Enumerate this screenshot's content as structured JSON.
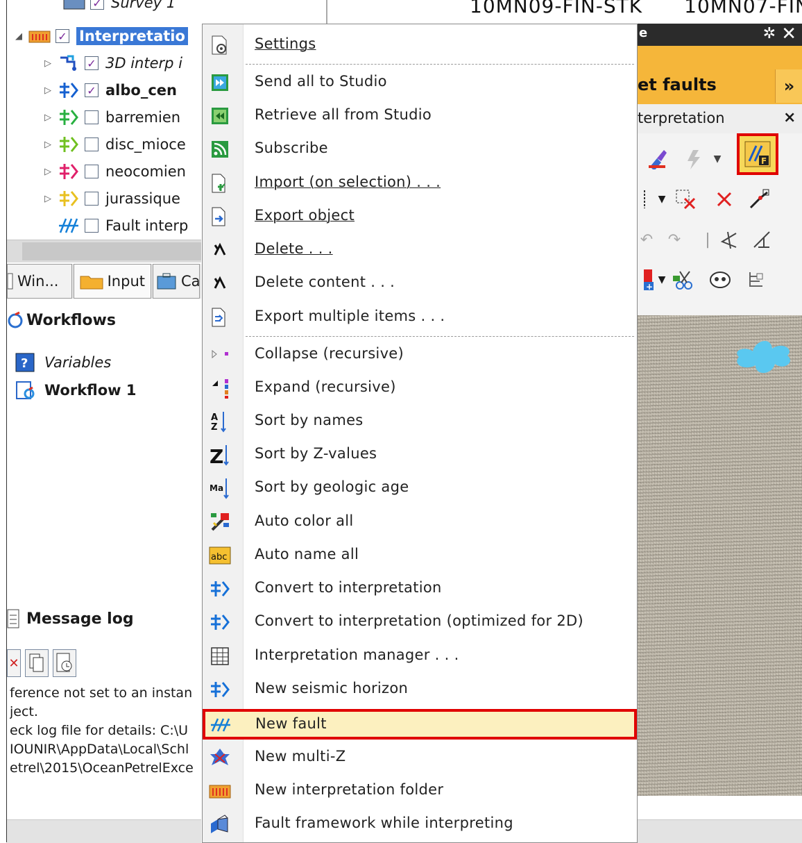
{
  "tree": {
    "items": [
      {
        "label": "Survey 1",
        "checked": true,
        "style": "italic"
      },
      {
        "label": "Interpretatio",
        "checked": true,
        "style": "selected"
      },
      {
        "label": "3D interp i",
        "checked": true,
        "style": "italic"
      },
      {
        "label": "albo_cen",
        "checked": true,
        "style": "bold"
      },
      {
        "label": "barremien",
        "checked": false,
        "style": "normal"
      },
      {
        "label": "disc_mioce",
        "checked": false,
        "style": "normal"
      },
      {
        "label": "neocomien",
        "checked": false,
        "style": "normal"
      },
      {
        "label": "jurassique",
        "checked": false,
        "style": "normal"
      },
      {
        "label": "Fault interp",
        "checked": false,
        "style": "normal"
      }
    ]
  },
  "tabs": [
    {
      "label": "Win...",
      "icon": "window-icon"
    },
    {
      "label": "Input",
      "icon": "folder-icon"
    },
    {
      "label": "Ca",
      "icon": "case-icon"
    }
  ],
  "workflows": {
    "title": "Workflows",
    "items": [
      {
        "label": "Variables",
        "style": "italic"
      },
      {
        "label": "Workflow 1",
        "style": "bold"
      }
    ]
  },
  "message_log": {
    "title": "Message log",
    "lines": [
      "ference not set to an instan",
      "ject.",
      "eck log file for details: C:\\U",
      "IOUNIR\\AppData\\Local\\Schl",
      "etrel\\2015\\OceanPetrelExce"
    ]
  },
  "seismic_header": {
    "columns": [
      "10MN09-FIN-STK",
      "10MN07-FIN"
    ]
  },
  "floating_window": {
    "title_fragment": "e",
    "tab_label": "et faults",
    "chevron": "»",
    "subtitle": "terpretation",
    "close": "×",
    "colors": {
      "title_bg": "#2b2b2b",
      "tab_bg": "#f5b63a",
      "highlight": "#e00000"
    }
  },
  "context_menu": {
    "items": [
      {
        "label": "Settings",
        "icon": "settings-icon",
        "underline": "S"
      },
      {
        "label": "Send all to Studio",
        "icon": "send-studio-icon"
      },
      {
        "label": "Retrieve all from Studio",
        "icon": "retrieve-studio-icon"
      },
      {
        "label": "Subscribe",
        "icon": "subscribe-icon"
      },
      {
        "label": "Import (on selection) . . .",
        "icon": "import-icon",
        "underline": "I"
      },
      {
        "label": "Export object",
        "icon": "export-icon",
        "underline": "E"
      },
      {
        "label": "Delete . . .",
        "icon": "delete-icon",
        "underline": "D"
      },
      {
        "label": "Delete content . . .",
        "icon": "delete-content-icon"
      },
      {
        "label": "Export multiple items . . .",
        "icon": "export-multiple-icon"
      },
      {
        "label": "Collapse (recursive)",
        "icon": "collapse-icon"
      },
      {
        "label": "Expand (recursive)",
        "icon": "expand-icon"
      },
      {
        "label": "Sort by names",
        "icon": "sort-names-icon"
      },
      {
        "label": "Sort by Z-values",
        "icon": "sort-z-icon"
      },
      {
        "label": "Sort by geologic age",
        "icon": "sort-age-icon"
      },
      {
        "label": "Auto color all",
        "icon": "auto-color-icon"
      },
      {
        "label": "Auto name all",
        "icon": "auto-name-icon"
      },
      {
        "label": "Convert to interpretation",
        "icon": "convert-icon"
      },
      {
        "label": "Convert to interpretation (optimized for 2D)",
        "icon": "convert-2d-icon"
      },
      {
        "label": "Interpretation manager . . .",
        "icon": "table-icon"
      },
      {
        "label": "New seismic horizon",
        "icon": "horizon-icon"
      },
      {
        "label": "New fault",
        "icon": "fault-icon",
        "highlighted": true
      },
      {
        "label": "New multi-Z",
        "icon": "multi-z-icon"
      },
      {
        "label": "New interpretation folder",
        "icon": "folder-icon"
      },
      {
        "label": "Fault framework while interpreting",
        "icon": "framework-icon"
      }
    ]
  }
}
